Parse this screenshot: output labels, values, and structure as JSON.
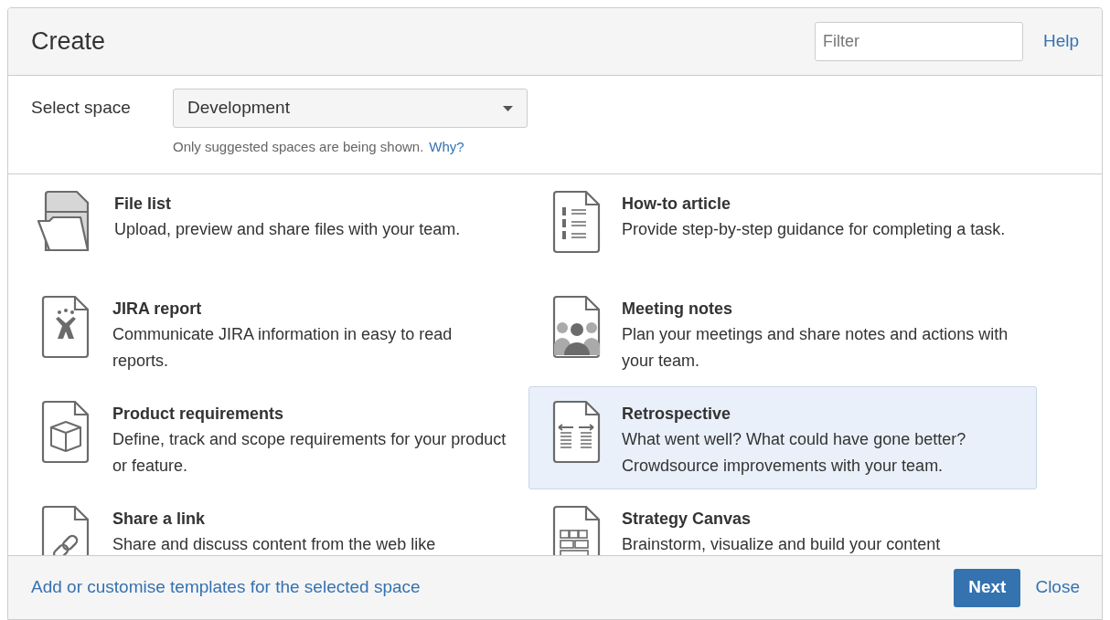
{
  "dialog": {
    "title": "Create",
    "filter": {
      "placeholder": "Filter"
    },
    "help": "Help"
  },
  "space": {
    "label": "Select space",
    "value": "Development",
    "hint": "Only suggested spaces are being shown.",
    "hint_link": "Why?"
  },
  "templates": [
    {
      "title": "File list",
      "description": "Upload, preview and share files with your team.",
      "selected": false
    },
    {
      "title": "How-to article",
      "description": "Provide step-by-step guidance for completing a task.",
      "selected": false
    },
    {
      "title": "JIRA report",
      "description": "Communicate JIRA information in easy to read reports.",
      "selected": false
    },
    {
      "title": "Meeting notes",
      "description": "Plan your meetings and share notes and actions with your team.",
      "selected": false
    },
    {
      "title": "Product requirements",
      "description": "Define, track and scope requirements for your product or feature.",
      "selected": false
    },
    {
      "title": "Retrospective",
      "description": "What went well? What could have gone better? Crowdsource improvements with your team.",
      "selected": true
    },
    {
      "title": "Share a link",
      "description": "Share and discuss content from the web like",
      "selected": false
    },
    {
      "title": "Strategy Canvas",
      "description": "Brainstorm, visualize and build your content",
      "selected": false
    }
  ],
  "footer": {
    "link": "Add or customise templates for the selected space",
    "next": "Next",
    "close": "Close"
  }
}
